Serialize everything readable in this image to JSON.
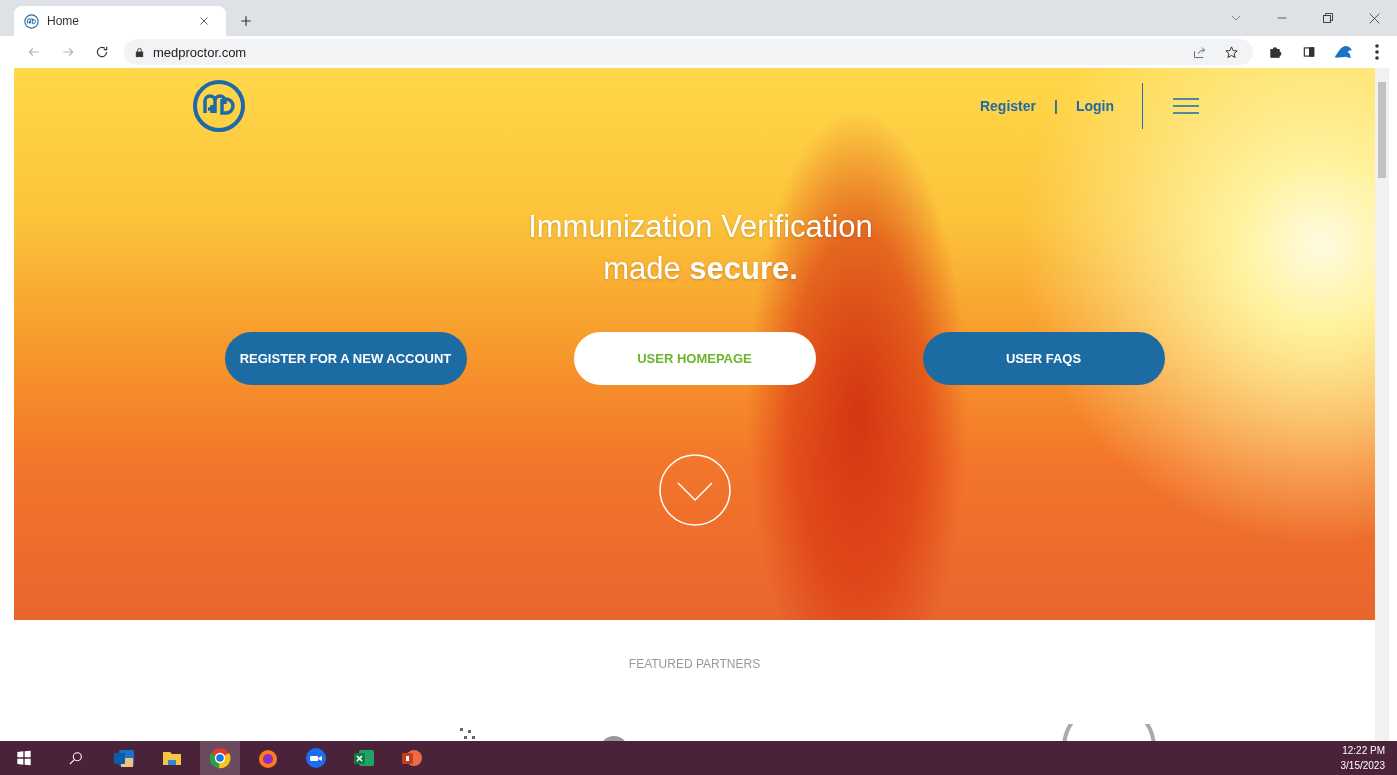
{
  "browser": {
    "tab": {
      "title": "Home",
      "selected": true
    },
    "url": "medproctor.com"
  },
  "site": {
    "nav": {
      "register": "Register",
      "separator": "|",
      "login": "Login"
    },
    "hero": {
      "heading_lines": [
        "Immunization Verification",
        "made **secure.**"
      ],
      "buttons": [
        {
          "label": "REGISTER FOR A NEW ACCOUNT",
          "kind": "primary"
        },
        {
          "label": "USER HOMEPAGE",
          "kind": "light"
        },
        {
          "label": "USER FAQS",
          "kind": "primary"
        }
      ]
    },
    "partners": {
      "title": "FEATURED PARTNERS"
    }
  },
  "taskbar": {
    "apps": [
      {
        "kind": "outlook",
        "selected": false
      },
      {
        "kind": "explorer",
        "selected": false
      },
      {
        "kind": "chrome",
        "selected": true
      },
      {
        "kind": "firefox",
        "selected": false
      },
      {
        "kind": "zoom",
        "selected": false
      },
      {
        "kind": "excel",
        "selected": false
      },
      {
        "kind": "powerpoint",
        "selected": false
      }
    ],
    "time": "12:22 PM",
    "date": "3/15/2023"
  }
}
